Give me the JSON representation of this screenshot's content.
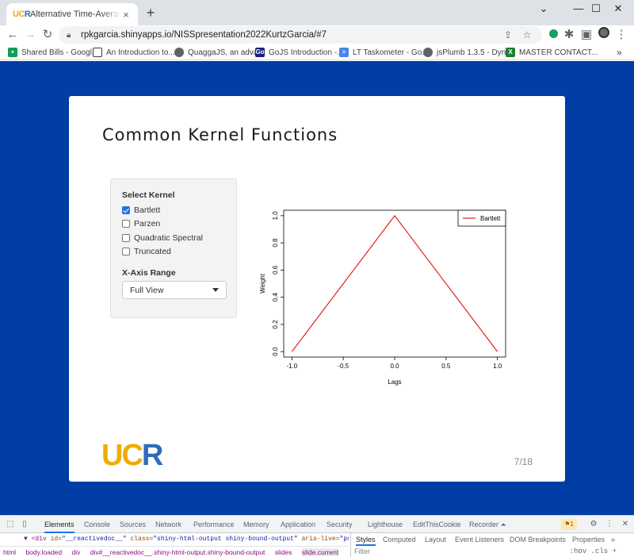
{
  "browser": {
    "tab_title": "Alternative Time-Average Covari",
    "tab_close": "×",
    "new_tab": "+",
    "window_controls": [
      "⌄",
      "—",
      "☐",
      "✕"
    ],
    "url": "rpkgarcia.shinyapps.io/NISSpresentation2022KurtzGarcia/#7",
    "bookmarks": [
      {
        "label": "Shared Bills - Googl...",
        "icon_color": "#0f9d58",
        "icon": "sheets-icon"
      },
      {
        "label": "An Introduction to...",
        "icon_color": "#3c4043",
        "icon": "page-icon"
      },
      {
        "label": "QuaggaJS, an adva...",
        "icon_color": "#5f6368",
        "icon": "globe-icon"
      },
      {
        "label": "GoJS Introduction -...",
        "icon_color": "#1a237e",
        "icon": "gojs-icon"
      },
      {
        "label": "LT Taskometer - Go...",
        "icon_color": "#4285f4",
        "icon": "docs-icon"
      },
      {
        "label": "jsPlumb 1.3.5 - Dyn...",
        "icon_color": "#5f6368",
        "icon": "globe-icon"
      },
      {
        "label": "MASTER CONTACT...",
        "icon_color": "#1e7e34",
        "icon": "excel-icon"
      }
    ],
    "bookmarks_more": "»"
  },
  "slide": {
    "title": "Common Kernel Functions",
    "page_number": "7/18",
    "logo": {
      "u": "U",
      "c": "C",
      "r": "R"
    },
    "controls": {
      "select_kernel_label": "Select Kernel",
      "options": [
        {
          "label": "Bartlett",
          "checked": true
        },
        {
          "label": "Parzen",
          "checked": false
        },
        {
          "label": "Quadratic Spectral",
          "checked": false
        },
        {
          "label": "Truncated",
          "checked": false
        }
      ],
      "x_axis_label": "X-Axis Range",
      "x_axis_value": "Full View"
    }
  },
  "chart_data": {
    "type": "line",
    "xlabel": "Lags",
    "ylabel": "Weight",
    "xlim": [
      -1.0,
      1.0
    ],
    "ylim": [
      0.0,
      1.0
    ],
    "xticks": [
      "-1.0",
      "-0.5",
      "0.0",
      "0.5",
      "1.0"
    ],
    "yticks": [
      "0.0",
      "0.2",
      "0.4",
      "0.6",
      "0.8",
      "1.0"
    ],
    "legend_position": "top-right",
    "series": [
      {
        "name": "Bartlett",
        "color": "#e02020",
        "x": [
          -1.0,
          0.0,
          1.0
        ],
        "y": [
          0.0,
          1.0,
          0.0
        ]
      }
    ]
  },
  "devtools": {
    "tabs": [
      "Elements",
      "Console",
      "Sources",
      "Network",
      "Performance",
      "Memory",
      "Application",
      "Security",
      "Lighthouse",
      "EditThisCookie",
      "Recorder ⏶"
    ],
    "issues_badge": "1",
    "code_line": {
      "tag_open": "▼ <div ",
      "id_attr": "id=",
      "id_val": "\"__reactivedoc__\"",
      "class_attr": " class=",
      "class_val": "\"shiny-html-output shiny-bound-output\"",
      "aria_attr": " aria-live=",
      "aria_val": "\"pol"
    },
    "breadcrumbs": [
      "html",
      "body.loaded",
      "div",
      "div#__reactivedoc__.shiny-html-output.shiny-bound-output",
      "slides",
      "slide.current"
    ],
    "side_tabs": [
      "Styles",
      "Computed",
      "Layout",
      "Event Listeners",
      "DOM Breakpoints",
      "Properties",
      "»"
    ],
    "filter_placeholder": "Filter",
    "hov_cls": ":hov  .cls  +"
  }
}
